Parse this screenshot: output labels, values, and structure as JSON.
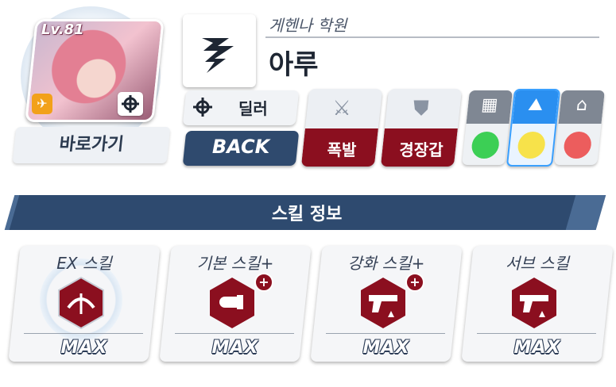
{
  "character": {
    "level": "Lv.81",
    "school": "게헨나 학원",
    "name": "아루",
    "shortcut_label": "바로가기",
    "role_label": "딜러",
    "back_label": "BACK",
    "attack_type": "폭발",
    "armor_type": "경장갑",
    "colors": {
      "attack": "#8b0f1f",
      "back": "#2f4a6e",
      "accent_blue": "#2a8ff0"
    }
  },
  "terrain": [
    {
      "icon": "city-icon",
      "mood": "great",
      "face_color": "#3ccf55"
    },
    {
      "icon": "outdoor-icon",
      "mood": "neutral",
      "face_color": "#f7e24a",
      "selected": true
    },
    {
      "icon": "indoor-icon",
      "mood": "bad",
      "face_color": "#ec5d5d"
    }
  ],
  "skills": {
    "banner": "스킬 정보",
    "cards": [
      {
        "title": "EX 스킬",
        "level": "MAX",
        "icon": "bow-skill-icon",
        "plus": false
      },
      {
        "title": "기본 스킬+",
        "level": "MAX",
        "icon": "bullet-skill-icon",
        "plus": true
      },
      {
        "title": "강화 스킬+",
        "level": "MAX",
        "icon": "pistol-buff-icon",
        "plus": true
      },
      {
        "title": "서브 스킬",
        "level": "MAX",
        "icon": "pistol-buff-icon",
        "plus": false
      }
    ]
  }
}
